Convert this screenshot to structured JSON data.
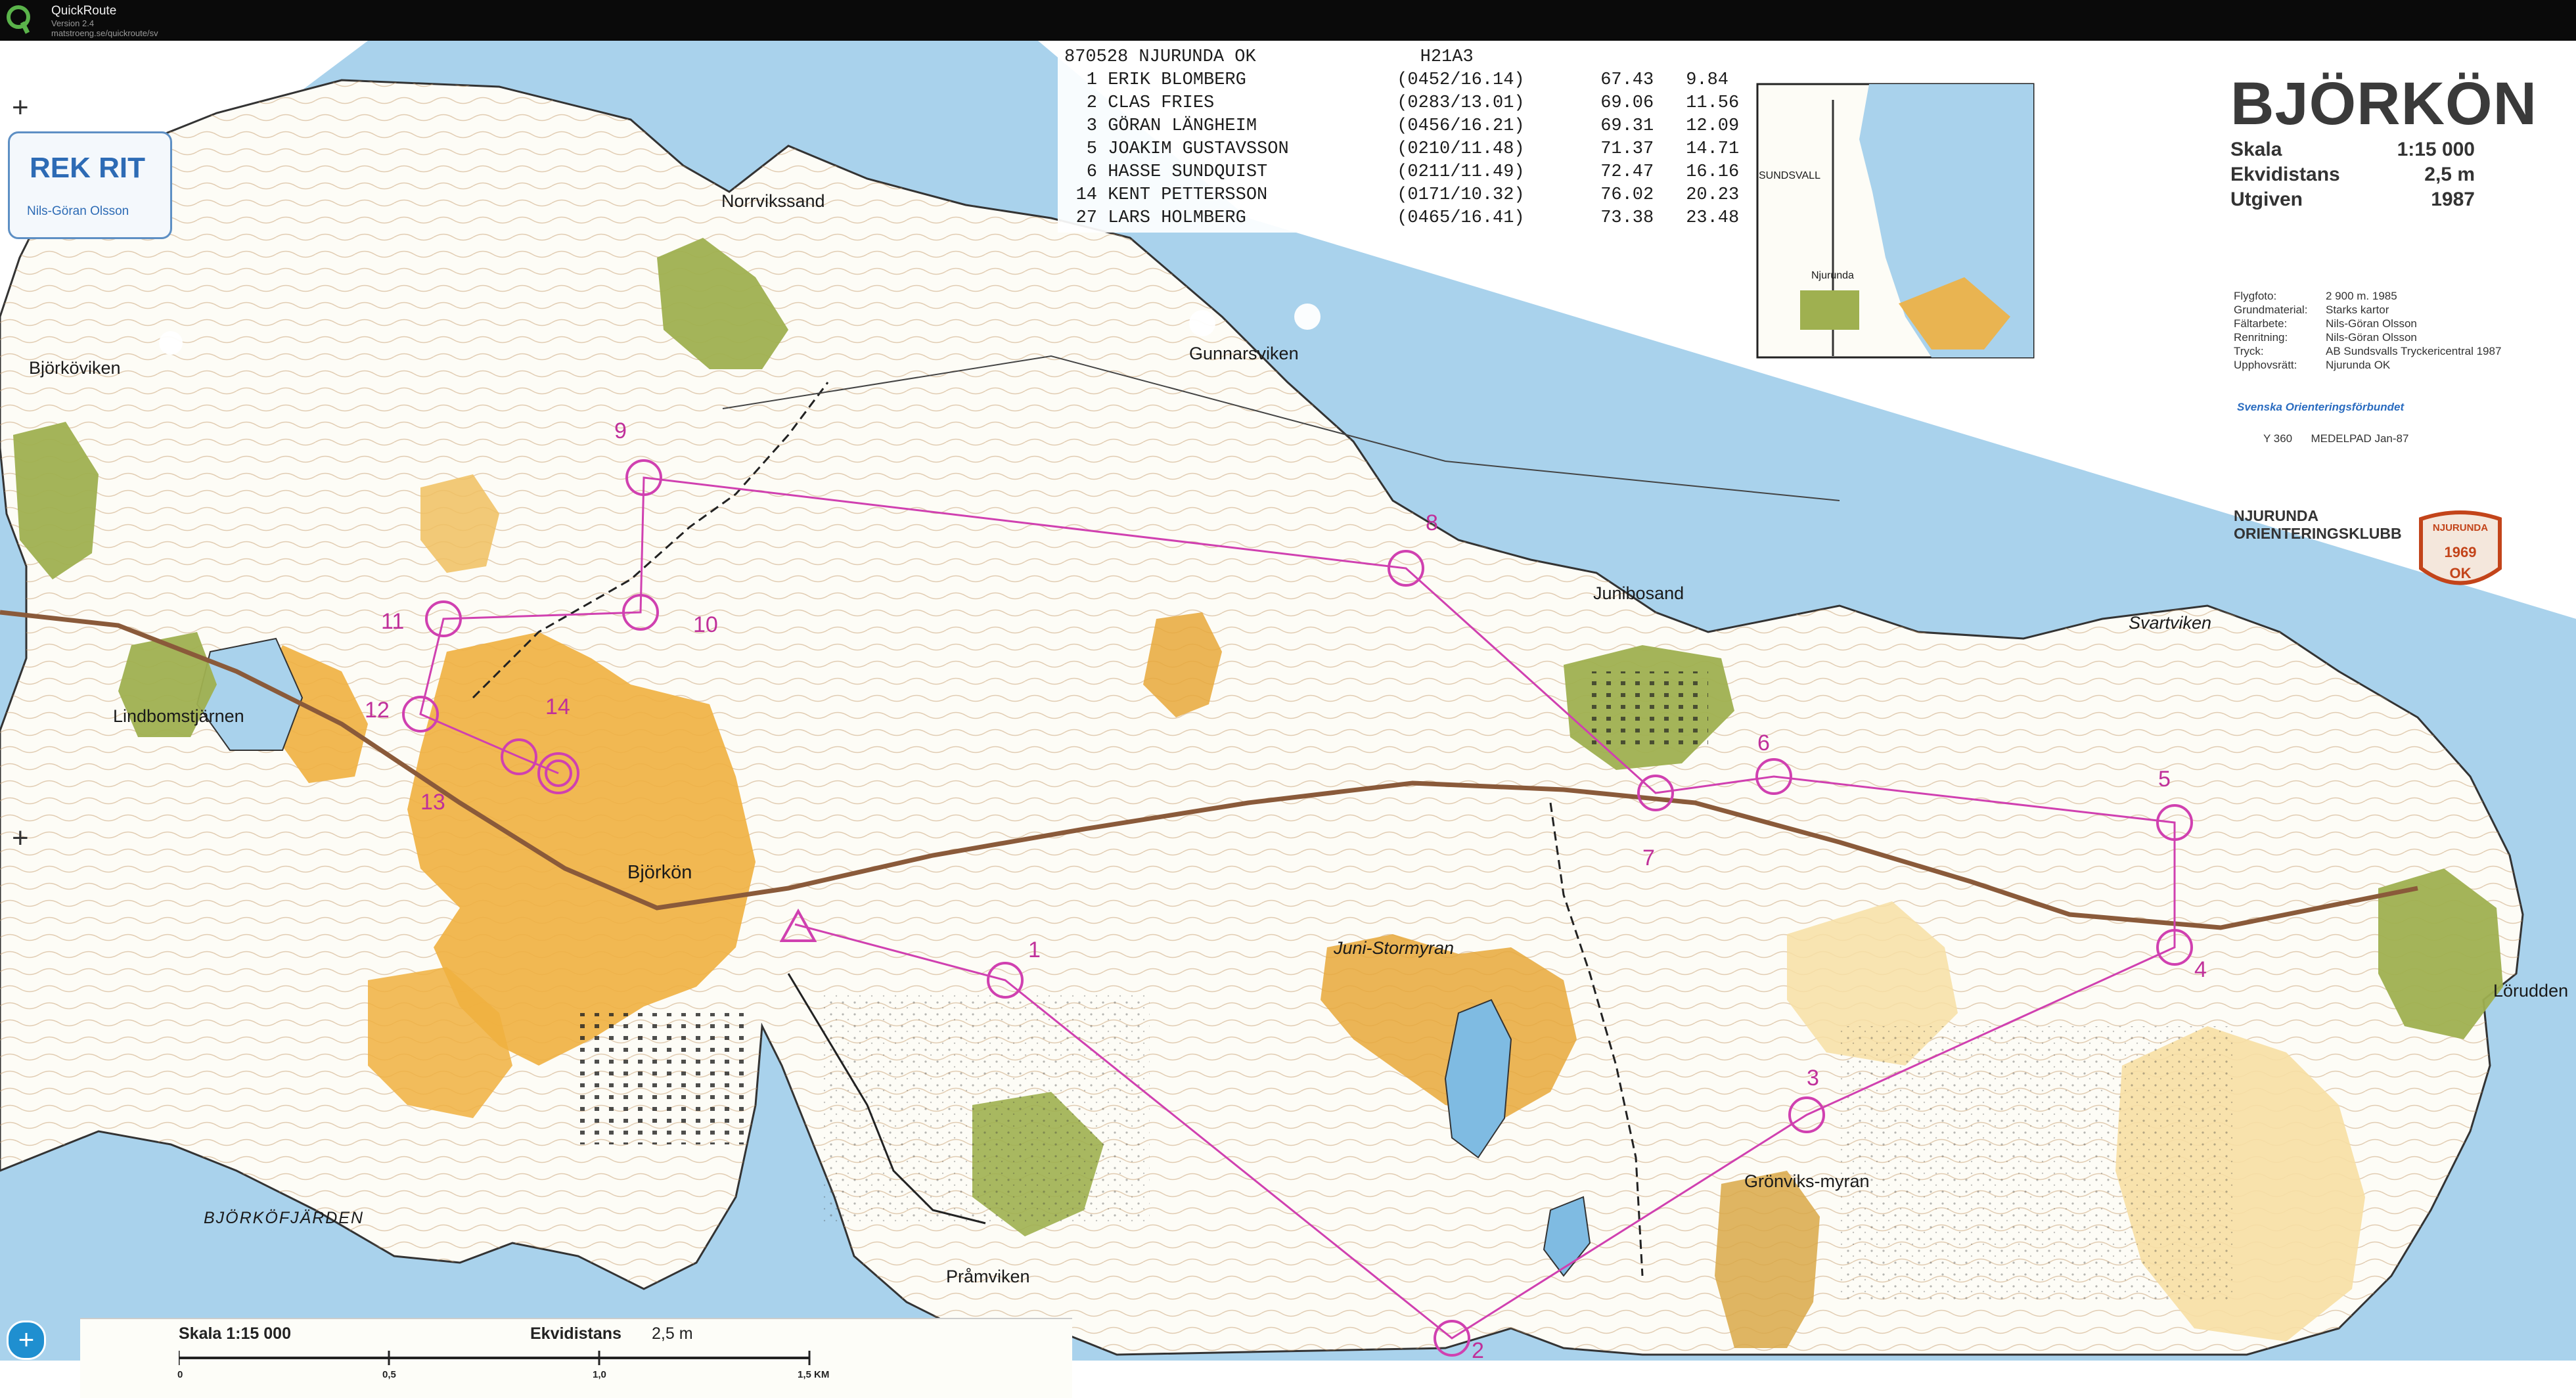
{
  "app": {
    "title": "QuickRoute",
    "version": "Version 2.4",
    "url": "matstroeng.se/quickroute/sv"
  },
  "results": {
    "header_event": "870528 NJURUNDA OK",
    "header_class": "H21A3",
    "rows": [
      {
        "place": "1",
        "name": "ERIK BLOMBERG",
        "split": "(0452/16.14)",
        "time": "67.43",
        "speed": "9.84"
      },
      {
        "place": "2",
        "name": "CLAS FRIES",
        "split": "(0283/13.01)",
        "time": "69.06",
        "speed": "11.56"
      },
      {
        "place": "3",
        "name": "GÖRAN LÄNGHEIM",
        "split": "(0456/16.21)",
        "time": "69.31",
        "speed": "12.09"
      },
      {
        "place": "5",
        "name": "JOAKIM GUSTAVSSON",
        "split": "(0210/11.48)",
        "time": "71.37",
        "speed": "14.71"
      },
      {
        "place": "6",
        "name": "HASSE SUNDQUIST",
        "split": "(0211/11.49)",
        "time": "72.47",
        "speed": "16.16"
      },
      {
        "place": "14",
        "name": "KENT PETTERSSON",
        "split": "(0171/10.32)",
        "time": "76.02",
        "speed": "20.23"
      },
      {
        "place": "27",
        "name": "LARS HOLMBERG",
        "split": "(0465/16.41)",
        "time": "73.38",
        "speed": "23.48"
      }
    ]
  },
  "title_block": {
    "map_name": "BJÖRKÖN",
    "specs": [
      {
        "label": "Skala",
        "value": "1:15 000"
      },
      {
        "label": "Ekvidistans",
        "value": "2,5 m"
      },
      {
        "label": "Utgiven",
        "value": "1987"
      }
    ],
    "credits": [
      {
        "label": "Flygfoto:",
        "value": "2 900 m. 1985"
      },
      {
        "label": "Grundmaterial:",
        "value": "Starks kartor"
      },
      {
        "label": "Fältarbete:",
        "value": "Nils-Göran Olsson"
      },
      {
        "label": "Renritning:",
        "value": "Nils-Göran Olsson"
      },
      {
        "label": "Tryck:",
        "value": "AB Sundsvalls Tryckericentral 1987"
      },
      {
        "label": "Upphovsrätt:",
        "value": "Njurunda OK"
      }
    ],
    "federation": "Svenska Orienteringsförbundet",
    "sheet": "Y 360      MEDELPAD Jan-87",
    "club_line1": "NJURUNDA",
    "club_line2": "ORIENTERINGSKLUBB",
    "badge_top": "NJURUNDA",
    "badge_year": "1969",
    "badge_bottom": "OK"
  },
  "inset_map": {
    "labels": [
      "SUNDSVALL",
      "Njurunda"
    ]
  },
  "rekorit": {
    "logo": "REK RIT",
    "author": "Nils-Göran Olsson"
  },
  "scale_bar": {
    "scale_label": "Skala 1:15 000",
    "ekvi_label": "Ekvidistans",
    "ekvi_value": "2,5 m",
    "ticks": [
      "0",
      "0,5",
      "1,0",
      "1,5 KM"
    ]
  },
  "place_names": [
    "Norrvikssand",
    "Björköviken",
    "Gunnarsviken",
    "Lindbomstjärnen",
    "Björkön",
    "Junibosand",
    "Svartviken",
    "Juni-Stormyran",
    "Grönviks-myran",
    "Lörudden",
    "BJÖRKÖFJÄRDEN",
    "Pråmviken"
  ],
  "controls": [
    "1",
    "2",
    "3",
    "4",
    "5",
    "6",
    "7",
    "8",
    "9",
    "10",
    "11",
    "12",
    "13",
    "14"
  ],
  "colors": {
    "water": "#a9d2ec",
    "open_land": "#f0b040",
    "rough_open": "#f7dfa4",
    "forest": "#ffffff",
    "settlement": "#9fb050",
    "course": "#d040b0",
    "contour": "#b58a5c"
  },
  "nav": {
    "plus_top": "+",
    "plus_mid": "+",
    "zoom": "+"
  }
}
